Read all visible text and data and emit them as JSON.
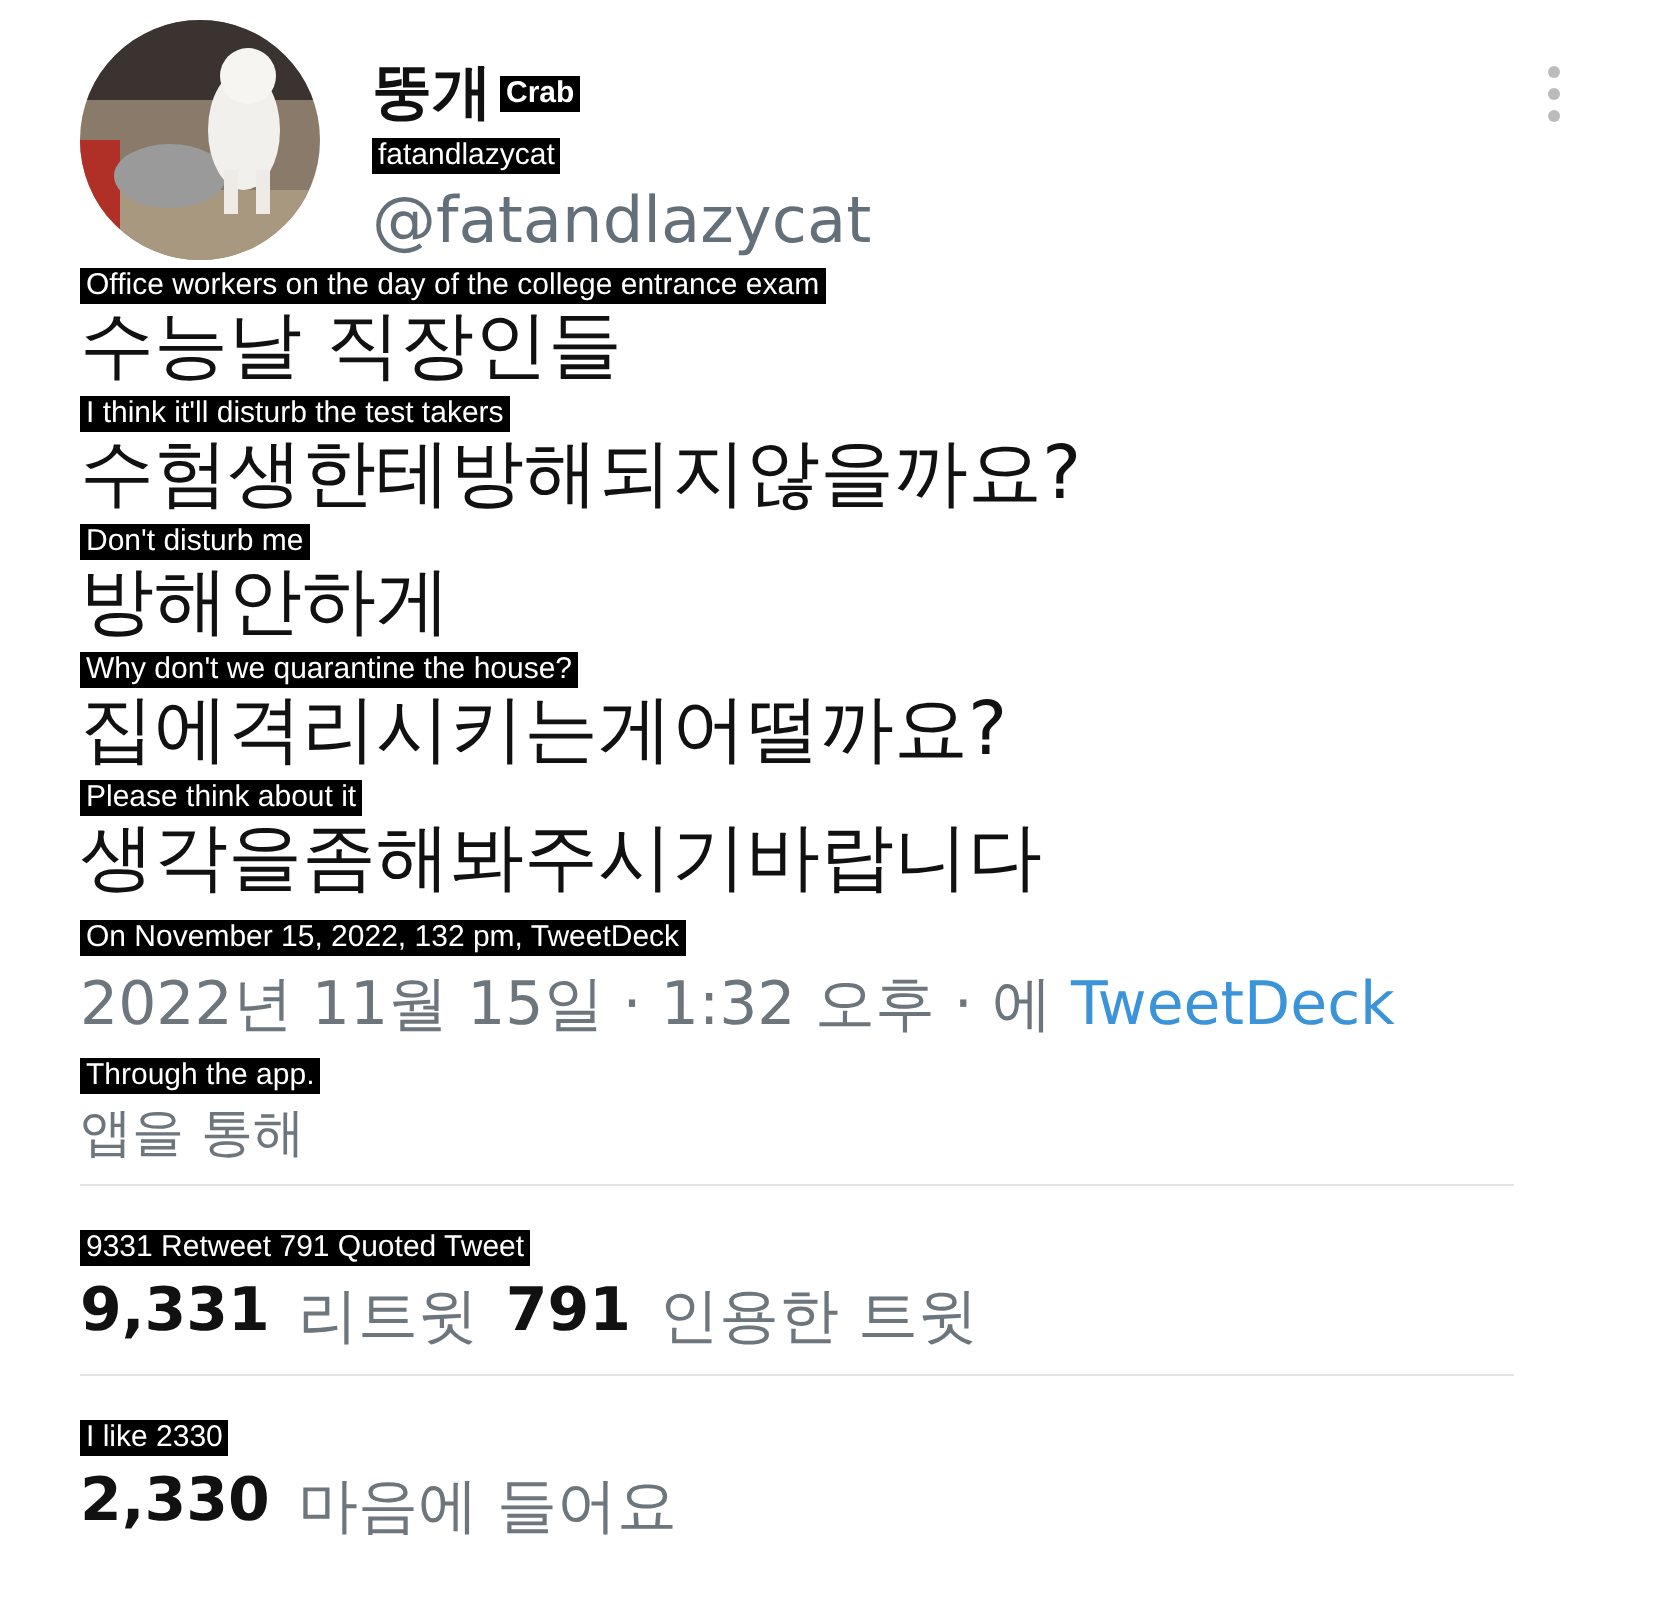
{
  "author": {
    "name": "뚱개",
    "name_translation": "Crab",
    "handle": "@fatandlazycat",
    "handle_translation": "fatandlazycat"
  },
  "body": [
    {
      "translation": "Office workers on the day of the college entrance exam",
      "text": "수능날 직장인들"
    },
    {
      "translation": "I think it'll disturb the test takers",
      "text": "수험생한테방해되지않을까요?"
    },
    {
      "translation": "Don't disturb me",
      "text": "방해안하게"
    },
    {
      "translation": "Why don't we quarantine the house?",
      "text": "집에격리시키는게어떨까요?"
    },
    {
      "translation": "Please think about it",
      "text": "생각을좀해봐주시기바랍니다"
    }
  ],
  "meta": {
    "translation": "On November 15, 2022, 132 pm, TweetDeck",
    "date": "2022년 11월 15일 · 1:32 오후 · 에",
    "source": "TweetDeck",
    "via_translation": "Through the app.",
    "via": "앱을 통해"
  },
  "stats": [
    {
      "translation": "9331 Retweet 791 Quoted Tweet",
      "items": [
        {
          "count": "9,331",
          "label": "리트윗"
        },
        {
          "count": "791",
          "label": "인용한 트윗"
        }
      ]
    },
    {
      "translation": "I like 2330",
      "items": [
        {
          "count": "2,330",
          "label": "마음에 들어요"
        }
      ]
    }
  ]
}
